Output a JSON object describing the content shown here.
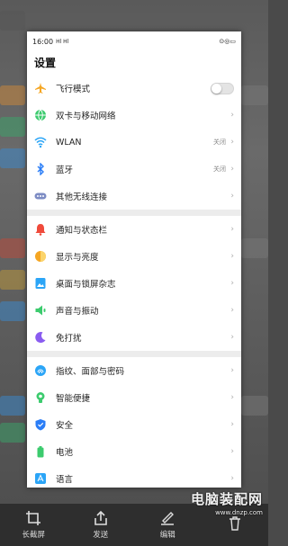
{
  "status_bar": {
    "time": "16:00",
    "signal": "Hl Hl",
    "right_icons": "⊙◎▭"
  },
  "header": {
    "title": "设置"
  },
  "groups": [
    {
      "items": [
        {
          "label": "飞行模式",
          "icon": "airplane-icon",
          "color": "#f5a623",
          "control": "toggle",
          "on": false
        },
        {
          "label": "双卡与移动网络",
          "icon": "globe-icon",
          "color": "#3ccb6e",
          "control": "chevron"
        },
        {
          "label": "WLAN",
          "icon": "wifi-icon",
          "color": "#2ba5f7",
          "value": "关闭",
          "control": "chevron"
        },
        {
          "label": "蓝牙",
          "icon": "bluetooth-icon",
          "color": "#2a7df7",
          "value": "关闭",
          "control": "chevron"
        },
        {
          "label": "其他无线连接",
          "icon": "dots-icon",
          "color": "#7d8cc4",
          "control": "chevron"
        }
      ]
    },
    {
      "items": [
        {
          "label": "通知与状态栏",
          "icon": "bell-icon",
          "color": "#f04a3b",
          "control": "chevron"
        },
        {
          "label": "显示与亮度",
          "icon": "brightness-icon",
          "color": "#f5a623",
          "control": "chevron"
        },
        {
          "label": "桌面与锁屏杂志",
          "icon": "image-icon",
          "color": "#2ba5f7",
          "control": "chevron"
        },
        {
          "label": "声音与振动",
          "icon": "speaker-icon",
          "color": "#3ccb6e",
          "control": "chevron"
        },
        {
          "label": "免打扰",
          "icon": "moon-icon",
          "color": "#8a5cf0",
          "control": "chevron"
        }
      ]
    },
    {
      "items": [
        {
          "label": "指纹、面部与密码",
          "icon": "fingerprint-icon",
          "color": "#2ba5f7",
          "control": "chevron"
        },
        {
          "label": "智能便捷",
          "icon": "smart-icon",
          "color": "#3ccb6e",
          "control": "chevron"
        },
        {
          "label": "安全",
          "icon": "shield-icon",
          "color": "#2a7df7",
          "control": "chevron"
        },
        {
          "label": "电池",
          "icon": "battery-icon",
          "color": "#3ccb6e",
          "control": "chevron"
        },
        {
          "label": "语言",
          "icon": "language-icon",
          "color": "#2ba5f7",
          "control": "chevron"
        }
      ]
    }
  ],
  "toolbar": {
    "items": [
      {
        "label": "长截屏",
        "icon": "crop-icon"
      },
      {
        "label": "发送",
        "icon": "share-icon"
      },
      {
        "label": "编辑",
        "icon": "edit-icon"
      },
      {
        "label": "",
        "icon": "delete-icon"
      }
    ]
  },
  "watermark": {
    "title": "电脑装配网",
    "url": "www.dnzp.com"
  }
}
